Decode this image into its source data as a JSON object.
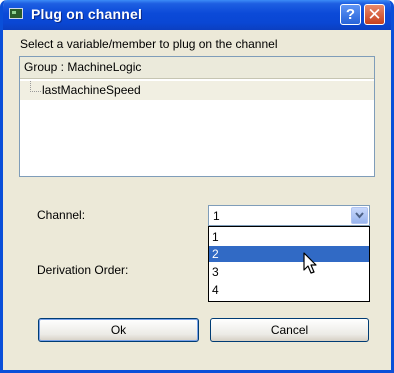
{
  "window": {
    "title": "Plug on channel"
  },
  "titlebar": {
    "help_label": "?",
    "close_label": "✕"
  },
  "instruction": "Select a variable/member to plug on the channel",
  "tree": {
    "header": "Group : MachineLogic",
    "items": [
      {
        "label": "lastMachineSpeed"
      }
    ]
  },
  "channel": {
    "label": "Channel:",
    "selected_value": "1",
    "options": [
      "1",
      "2",
      "3",
      "4"
    ],
    "highlighted_option": "2"
  },
  "derivation": {
    "label": "Derivation Order:"
  },
  "buttons": {
    "ok_label": "Ok",
    "cancel_label": "Cancel"
  },
  "colors": {
    "titlebar": "#0a47d4",
    "dialog_background": "#ece9d8",
    "selection": "#316ac5"
  },
  "icons": [
    "app-icon",
    "help-icon",
    "close-icon",
    "chevron-down-icon",
    "mouse-cursor-icon"
  ]
}
